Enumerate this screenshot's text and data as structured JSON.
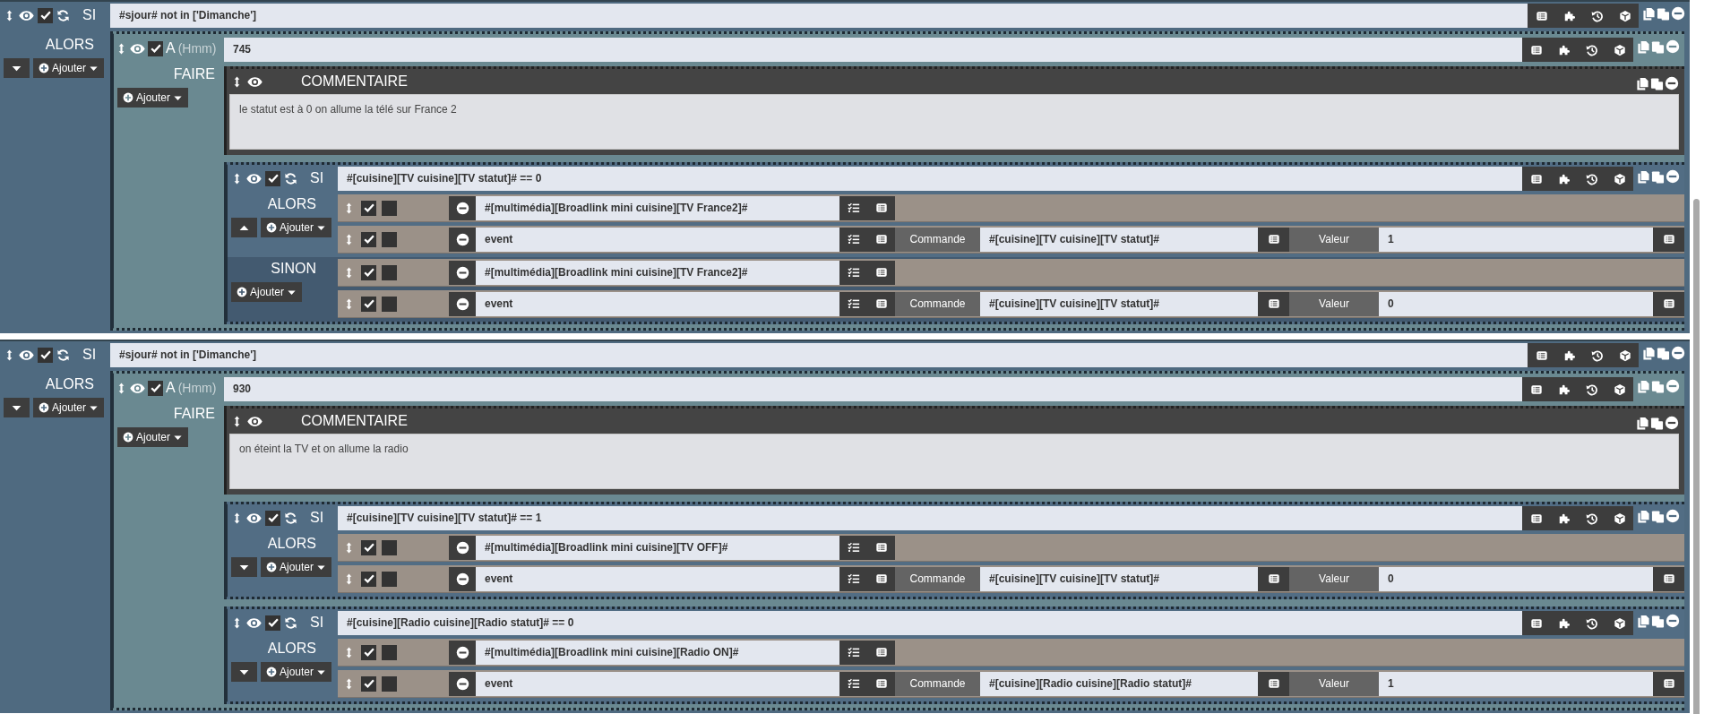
{
  "blocks": [
    {
      "kind": "si",
      "enabled": true,
      "label": "SI",
      "condition": "#sjour# not in ['Dimanche']",
      "then": {
        "label": "ALORS",
        "expanded": false,
        "add_button": "Ajouter",
        "items": [
          {
            "kind": "a",
            "enabled": true,
            "label": "A",
            "hint": "(Hmm)",
            "value": "745",
            "do": {
              "label": "FAIRE",
              "add_button": "Ajouter",
              "items": [
                {
                  "kind": "comment",
                  "title": "COMMENTAIRE",
                  "text": "le statut est à 0 on allume la télé sur France 2"
                },
                {
                  "kind": "si",
                  "enabled": true,
                  "label": "SI",
                  "condition": "#[cuisine][TV cuisine][TV statut]# == 0",
                  "then": {
                    "label": "ALORS",
                    "expanded": true,
                    "add_button": "Ajouter",
                    "items": [
                      {
                        "kind": "action",
                        "enabled": true,
                        "parallel": false,
                        "command": "#[multimédia][Broadlink mini cuisine][TV France2]#"
                      },
                      {
                        "kind": "action",
                        "enabled": true,
                        "parallel": false,
                        "command": "event",
                        "options": [
                          {
                            "label": "Commande",
                            "value": "#[cuisine][TV cuisine][TV statut]#"
                          },
                          {
                            "label": "Valeur",
                            "value": "1"
                          }
                        ]
                      }
                    ]
                  },
                  "else": {
                    "label": "SINON",
                    "add_button": "Ajouter",
                    "items": [
                      {
                        "kind": "action",
                        "enabled": true,
                        "parallel": false,
                        "command": "#[multimédia][Broadlink mini cuisine][TV France2]#"
                      },
                      {
                        "kind": "action",
                        "enabled": true,
                        "parallel": false,
                        "command": "event",
                        "options": [
                          {
                            "label": "Commande",
                            "value": "#[cuisine][TV cuisine][TV statut]#"
                          },
                          {
                            "label": "Valeur",
                            "value": "0"
                          }
                        ]
                      }
                    ]
                  }
                }
              ]
            }
          }
        ]
      }
    },
    {
      "kind": "si",
      "enabled": true,
      "label": "SI",
      "condition": "#sjour# not in ['Dimanche']",
      "then": {
        "label": "ALORS",
        "expanded": false,
        "add_button": "Ajouter",
        "items": [
          {
            "kind": "a",
            "enabled": true,
            "label": "A",
            "hint": "(Hmm)",
            "value": "930",
            "do": {
              "label": "FAIRE",
              "add_button": "Ajouter",
              "items": [
                {
                  "kind": "comment",
                  "title": "COMMENTAIRE",
                  "text": "on éteint la TV et on allume la radio"
                },
                {
                  "kind": "si",
                  "enabled": true,
                  "label": "SI",
                  "condition": "#[cuisine][TV cuisine][TV statut]# == 1",
                  "then": {
                    "label": "ALORS",
                    "expanded": false,
                    "add_button": "Ajouter",
                    "items": [
                      {
                        "kind": "action",
                        "enabled": true,
                        "parallel": false,
                        "command": "#[multimédia][Broadlink mini cuisine][TV OFF]#"
                      },
                      {
                        "kind": "action",
                        "enabled": true,
                        "parallel": false,
                        "command": "event",
                        "options": [
                          {
                            "label": "Commande",
                            "value": "#[cuisine][TV cuisine][TV statut]#"
                          },
                          {
                            "label": "Valeur",
                            "value": "0"
                          }
                        ]
                      }
                    ]
                  }
                },
                {
                  "kind": "si",
                  "enabled": true,
                  "label": "SI",
                  "condition": "#[cuisine][Radio cuisine][Radio statut]# == 0",
                  "then": {
                    "label": "ALORS",
                    "expanded": false,
                    "add_button": "Ajouter",
                    "items": [
                      {
                        "kind": "action",
                        "enabled": true,
                        "parallel": false,
                        "command": "#[multimédia][Broadlink mini cuisine][Radio ON]#"
                      },
                      {
                        "kind": "action",
                        "enabled": true,
                        "parallel": false,
                        "command": "event",
                        "options": [
                          {
                            "label": "Commande",
                            "value": "#[cuisine][Radio cuisine][Radio statut]#"
                          },
                          {
                            "label": "Valeur",
                            "value": "1"
                          }
                        ]
                      }
                    ]
                  }
                }
              ]
            }
          }
        ]
      }
    }
  ]
}
